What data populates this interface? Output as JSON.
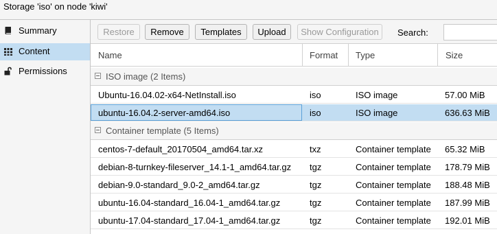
{
  "window": {
    "title": "Storage 'iso' on node 'kiwi'"
  },
  "sidebar": {
    "items": [
      {
        "label": "Summary",
        "icon": "book-icon",
        "active": false
      },
      {
        "label": "Content",
        "icon": "grid-icon",
        "active": true
      },
      {
        "label": "Permissions",
        "icon": "unlock-icon",
        "active": false
      }
    ]
  },
  "toolbar": {
    "restore_label": "Restore",
    "remove_label": "Remove",
    "templates_label": "Templates",
    "upload_label": "Upload",
    "show_config_label": "Show Configuration",
    "search_label": "Search:",
    "search_value": ""
  },
  "table": {
    "columns": [
      "Name",
      "Format",
      "Type",
      "Size"
    ],
    "groups": [
      {
        "label": "ISO image (2 Items)",
        "rows": [
          {
            "name": "Ubuntu-16.04.02-x64-NetInstall.iso",
            "format": "iso",
            "type": "ISO image",
            "size": "57.00 MiB",
            "selected": false
          },
          {
            "name": "ubuntu-16.04.2-server-amd64.iso",
            "format": "iso",
            "type": "ISO image",
            "size": "636.63 MiB",
            "selected": true
          }
        ]
      },
      {
        "label": "Container template (5 Items)",
        "rows": [
          {
            "name": "centos-7-default_20170504_amd64.tar.xz",
            "format": "txz",
            "type": "Container template",
            "size": "65.32 MiB",
            "selected": false
          },
          {
            "name": "debian-8-turnkey-fileserver_14.1-1_amd64.tar.gz",
            "format": "tgz",
            "type": "Container template",
            "size": "178.79 MiB",
            "selected": false
          },
          {
            "name": "debian-9.0-standard_9.0-2_amd64.tar.gz",
            "format": "tgz",
            "type": "Container template",
            "size": "188.48 MiB",
            "selected": false
          },
          {
            "name": "ubuntu-16.04-standard_16.04-1_amd64.tar.gz",
            "format": "tgz",
            "type": "Container template",
            "size": "187.99 MiB",
            "selected": false
          },
          {
            "name": "ubuntu-17.04-standard_17.04-1_amd64.tar.gz",
            "format": "tgz",
            "type": "Container template",
            "size": "192.01 MiB",
            "selected": false
          }
        ]
      }
    ]
  },
  "colors": {
    "selection": "#c2ddf2",
    "selection_border": "#5aa0d8",
    "panel": "#f5f5f5"
  }
}
